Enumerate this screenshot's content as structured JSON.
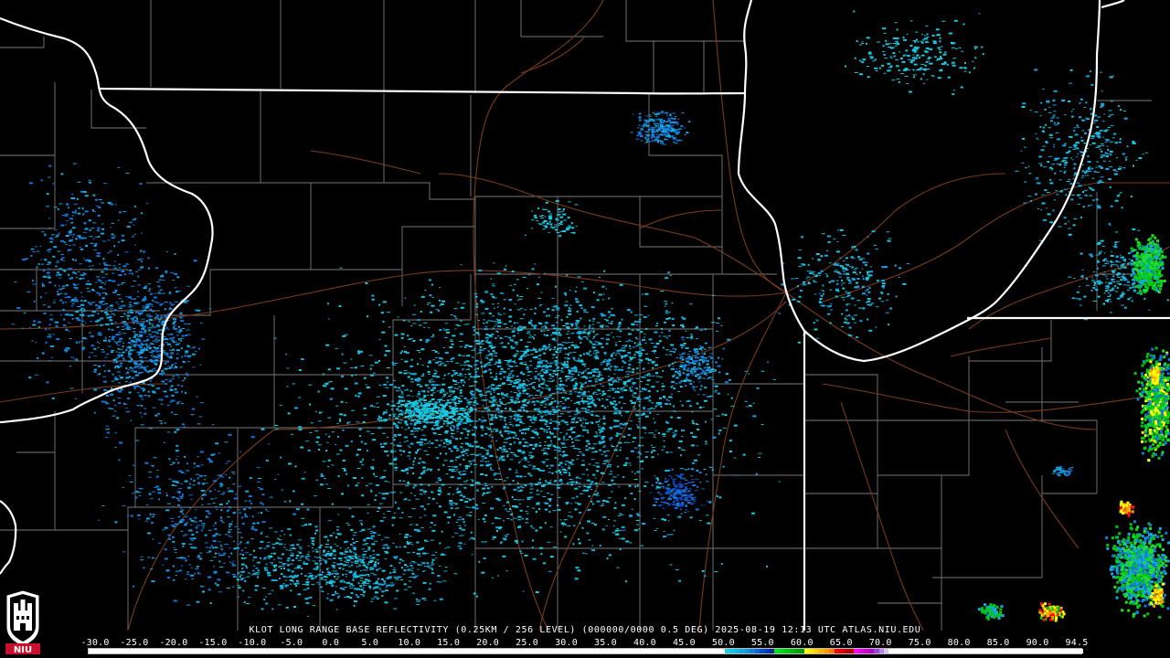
{
  "product": {
    "caption": "KLOT LONG RANGE BASE REFLECTIVITY (0.25KM / 256 LEVEL) (000000/0000 0.5 DEG) 2025-08-19 12:13 UTC  ATLAS.NIU.EDU"
  },
  "colors": {
    "background": "#000000",
    "state_border": "#ffffff",
    "county_border": "#7a7a7a",
    "highway": "#7a3c1a",
    "logo_red": "#c8102e"
  },
  "logo": {
    "text": "NIU"
  },
  "color_scale": {
    "tick_labels": [
      "-30.0",
      "-25.0",
      "-20.0",
      "-15.0",
      "-10.0",
      "-5.0",
      "0.0",
      "5.0",
      "10.0",
      "15.0",
      "20.0",
      "25.0",
      "30.0",
      "35.0",
      "40.0",
      "45.0",
      "50.0",
      "55.0",
      "60.0",
      "65.0",
      "70.0",
      "75.0",
      "80.0",
      "85.0",
      "90.0",
      "94.5"
    ],
    "swatch_colors": [
      "#ffffff",
      "#ffffff",
      "#ffffff",
      "#ffffff",
      "#ffffff",
      "#ffffff",
      "#ffffff",
      "#ffffff",
      "#ffffff",
      "#ffffff",
      "#ffffff",
      "#ffffff",
      "#ffffff",
      "#ffffff",
      "#ffffff",
      "#ffffff",
      "#ffffff",
      "#ffffff",
      "#ffffff",
      "#ffffff",
      "#ffffff",
      "#ffffff",
      "#ffffff",
      "#ffffff",
      "#ffffff",
      "#ffffff",
      "#ffffff",
      "#ffffff",
      "#ffffff",
      "#ffffff",
      "#ffffff",
      "#ffffff",
      "#ffffff",
      "#ffffff",
      "#ffffff",
      "#ffffff",
      "#ffffff",
      "#ffffff",
      "#ffffff",
      "#ffffff",
      "#ffffff",
      "#ffffff",
      "#ffffff",
      "#ffffff",
      "#ffffff",
      "#ffffff",
      "#ffffff",
      "#ffffff",
      "#ffffff",
      "#ffffff",
      "#ffffff",
      "#ffffff",
      "#ffffff",
      "#ffffff",
      "#ffffff",
      "#ffffff",
      "#ffffff",
      "#ffffff",
      "#ffffff",
      "#ffffff",
      "#ffffff",
      "#ffffff",
      "#ffffff",
      "#ffffff",
      "#ffffff",
      "#ffffff",
      "#ffffff",
      "#ffffff",
      "#ffffff",
      "#ffffff",
      "#ffffff",
      "#ffffff",
      "#ffffff",
      "#ffffff",
      "#ffffff",
      "#ffffff",
      "#ffffff",
      "#ffffff",
      "#ffffff",
      "#ffffff",
      "#ffffff",
      "#ffffff",
      "#ffffff",
      "#ffffff",
      "#ffffff",
      "#ffffff",
      "#ffffff",
      "#ffffff",
      "#ffffff",
      "#ffffff",
      "#ffffff",
      "#ffffff",
      "#ffffff",
      "#ffffff",
      "#ffffff",
      "#ffffff",
      "#ffffff",
      "#ffffff",
      "#ffffff",
      "#ffffff",
      "#ffffff",
      "#ffffff",
      "#ffffff",
      "#ffffff",
      "#ffffff",
      "#ffffff",
      "#ffffff",
      "#ffffff",
      "#ffffff",
      "#ffffff",
      "#ffffff",
      "#ffffff",
      "#ffffff",
      "#ffffff",
      "#ffffff",
      "#ffffff",
      "#ffffff",
      "#ffffff",
      "#ffffff",
      "#ffffff",
      "#ffffff",
      "#ffffff",
      "#ffffff",
      "#ffffff",
      "#ffffff",
      "#ffffff",
      "#ffffff",
      "#ffffff",
      "#1ad2e6",
      "#18c4e4",
      "#16b6e2",
      "#14a6df",
      "#1296dc",
      "#1080d8",
      "#0c68d2",
      "#0850c8",
      "#043ab4",
      "#00239a",
      "#00e21c",
      "#00d418",
      "#00c614",
      "#00b810",
      "#00aa0c",
      "#009c08",
      "#ffff00",
      "#ffe600",
      "#ffcc00",
      "#ffb200",
      "#ff9900",
      "#ff7a00",
      "#ff0000",
      "#e00000",
      "#c00000",
      "#a80000",
      "#ff00ff",
      "#e000e0",
      "#c800c8",
      "#b000d0",
      "#9c40d8",
      "#b888e0",
      "#d8c8ef",
      "#ffffff",
      "#ffffff",
      "#ffffff",
      "#ffffff",
      "#ffffff",
      "#ffffff",
      "#ffffff",
      "#ffffff",
      "#ffffff",
      "#ffffff",
      "#ffffff",
      "#ffffff",
      "#ffffff",
      "#ffffff",
      "#ffffff",
      "#ffffff",
      "#ffffff",
      "#ffffff",
      "#ffffff",
      "#ffffff",
      "#ffffff",
      "#ffffff",
      "#ffffff",
      "#ffffff",
      "#ffffff",
      "#ffffff",
      "#ffffff",
      "#ffffff",
      "#ffffff",
      "#ffffff",
      "#ffffff",
      "#ffffff",
      "#ffffff",
      "#ffffff",
      "#ffffff",
      "#ffffff",
      "#ffffff",
      "#ffffff",
      "#ffffff"
    ]
  },
  "echo_palette": {
    "light": "#1ac8e0",
    "medium": "#16a8e0",
    "moderate": "#1278dc",
    "heavy": "#0a48cc",
    "green": "#00c810",
    "bright_green": "#22e02a",
    "yellow": "#ffff00",
    "orange": "#ff9900",
    "red": "#ff1010"
  }
}
